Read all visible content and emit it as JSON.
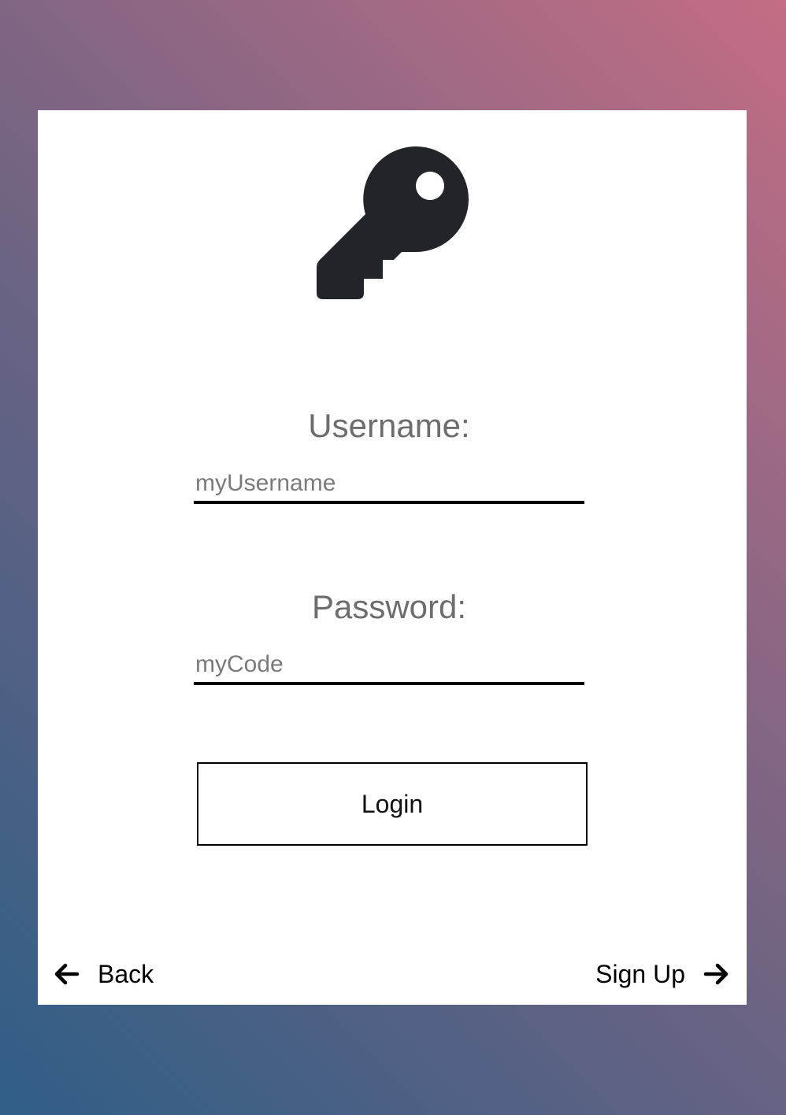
{
  "header": {
    "icon": "key-icon"
  },
  "form": {
    "username_label": "Username:",
    "username_placeholder": "myUsername",
    "username_value": "",
    "password_label": "Password:",
    "password_placeholder": "myCode",
    "password_value": "",
    "login_label": "Login"
  },
  "footer": {
    "back_label": "Back",
    "back_icon": "arrow-left-icon",
    "signup_label": "Sign Up",
    "signup_icon": "arrow-right-icon"
  },
  "colors": {
    "gradient_start": "#2f5e86",
    "gradient_mid": "#6b6383",
    "gradient_end": "#c46d84",
    "icon_color": "#212529",
    "label_color": "#6d6d6d"
  }
}
